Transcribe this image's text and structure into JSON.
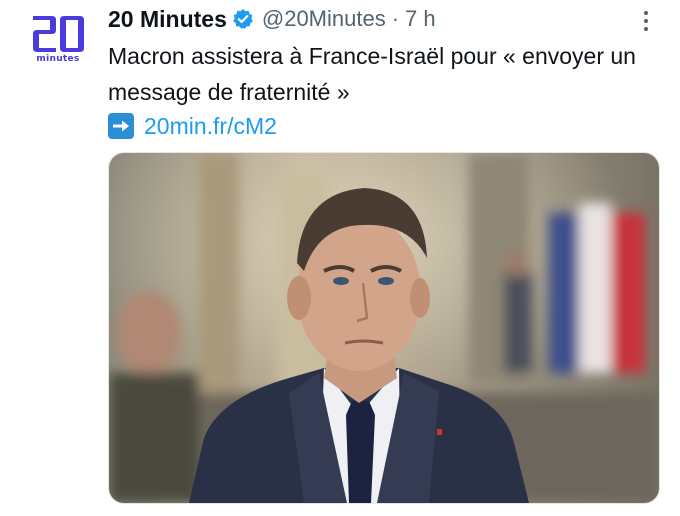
{
  "account": {
    "name": "20 Minutes",
    "handle": "@20Minutes",
    "separator": "·",
    "time": "7 h",
    "avatar_logo_number": "20",
    "avatar_logo_text": "minutes",
    "verified_icon": "verified-badge-icon"
  },
  "tweet": {
    "text": "Macron assistera à France-Israël pour « envoyer un message de fraternité »",
    "arrow_icon": "right-arrow-emoji-icon",
    "link": "20min.fr/cM2"
  },
  "media": {
    "description_icon": "news-photo"
  },
  "menu": {
    "icon": "more-options-icon"
  },
  "colors": {
    "brand": "#4b3bdc",
    "link": "#1d9bf0",
    "verified": "#1d9bf0",
    "secondary_text": "#536471"
  }
}
